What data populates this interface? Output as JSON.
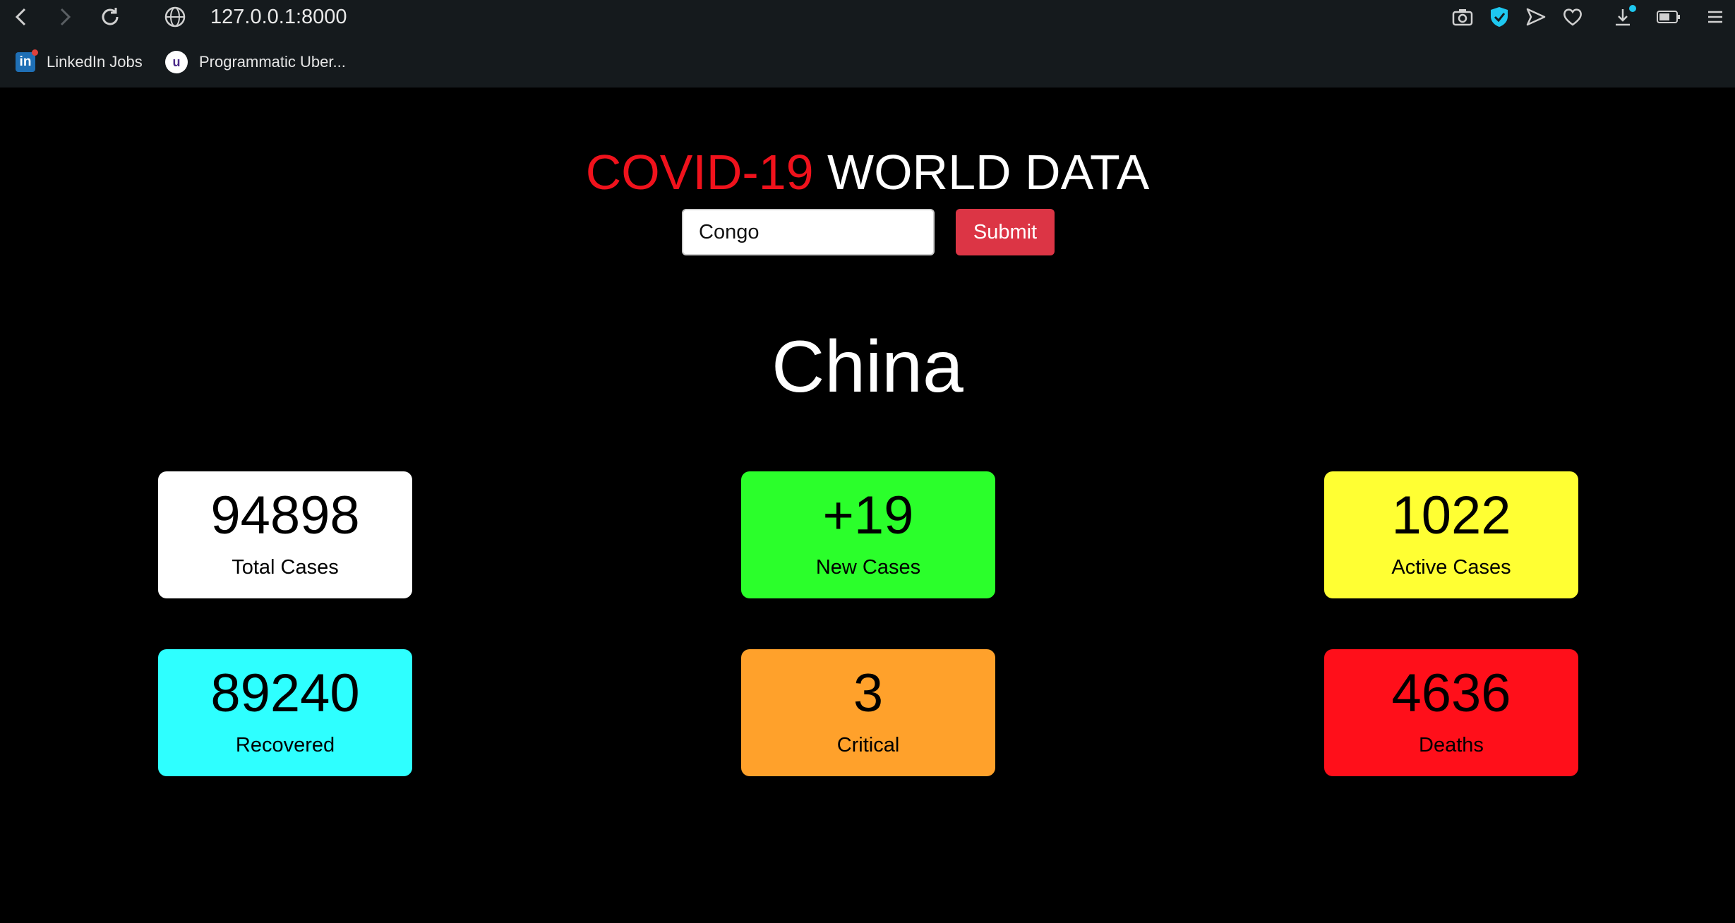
{
  "browser": {
    "url": "127.0.0.1:8000",
    "bookmarks": [
      {
        "label": "LinkedIn Jobs",
        "icon": "linkedin-icon"
      },
      {
        "label": "Programmatic Uber...",
        "icon": "udemy-icon"
      }
    ]
  },
  "header": {
    "title_highlight": "COVID-19",
    "title_rest": " WORLD DATA"
  },
  "search": {
    "value": "Congo",
    "submit_label": "Submit"
  },
  "country": "China",
  "stats": [
    {
      "value": "94898",
      "label": "Total Cases",
      "color": "#ffffff"
    },
    {
      "value": "+19",
      "label": "New Cases",
      "color": "#2bff2b"
    },
    {
      "value": "1022",
      "label": "Active Cases",
      "color": "#ffff33"
    },
    {
      "value": "89240",
      "label": "Recovered",
      "color": "#2effff"
    },
    {
      "value": "3",
      "label": "Critical",
      "color": "#ffa12b"
    },
    {
      "value": "4636",
      "label": "Deaths",
      "color": "#ff0f1a"
    }
  ],
  "colors": {
    "accent_red": "#f0121c",
    "submit": "#dc3545",
    "page_bg": "#000000",
    "chrome_bg": "#151a1d"
  }
}
